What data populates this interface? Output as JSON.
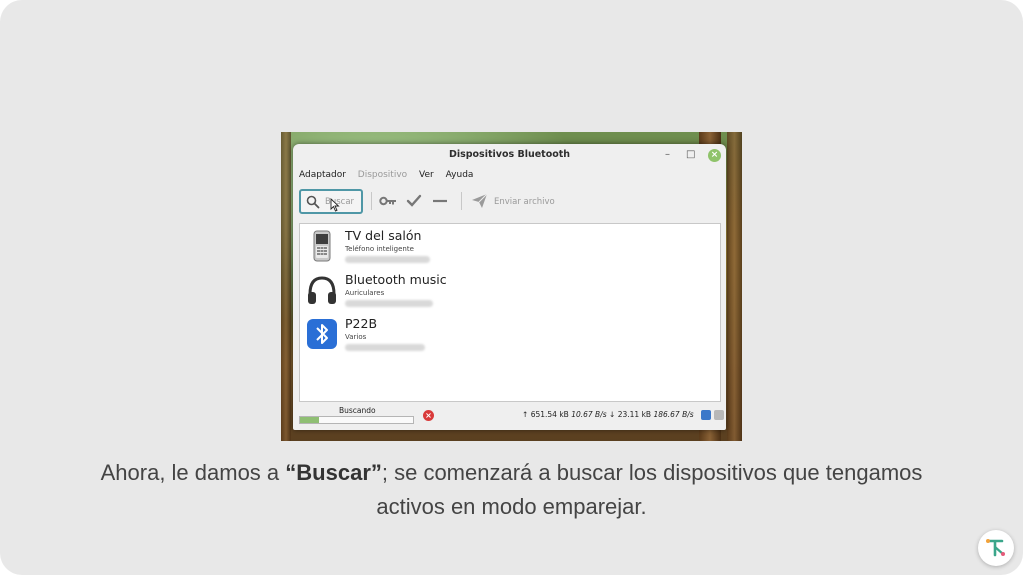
{
  "window": {
    "title": "Dispositivos Bluetooth",
    "minimize_glyph": "–",
    "maximize_glyph": "□",
    "close_glyph": "×"
  },
  "menu": {
    "items": [
      "Adaptador",
      "Dispositivo",
      "Ver",
      "Ayuda"
    ]
  },
  "toolbar": {
    "search_label": "Buscar",
    "send_label": "Enviar archivo"
  },
  "devices": [
    {
      "name": "TV del salón",
      "type": "Teléfono inteligente",
      "icon": "phone-icon"
    },
    {
      "name": "Bluetooth music",
      "type": "Auriculares",
      "icon": "headphones-icon"
    },
    {
      "name": "P22B",
      "type": "Varios",
      "icon": "bluetooth-icon"
    }
  ],
  "status": {
    "label": "Buscando",
    "progress": 0.17,
    "upload_total": "651.54 kB",
    "upload_rate": "10.67 B/s",
    "download_total": "23.11 kB",
    "download_rate": "186.67 B/s"
  },
  "caption": {
    "prefix": "Ahora, le damos a ",
    "bold": "“Buscar”",
    "suffix": "; se comenzará a buscar los dispositivos que tengamos activos en modo emparejar."
  },
  "colors": {
    "accent": "#4f97a6",
    "progress": "#8fbf73",
    "stop": "#d93a3a",
    "bluetooth": "#2a6fd6"
  }
}
